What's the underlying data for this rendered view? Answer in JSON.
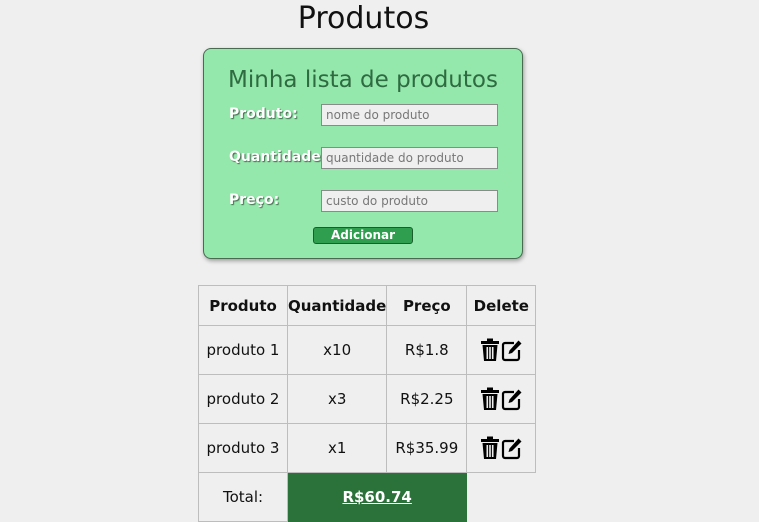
{
  "page": {
    "title": "Produtos"
  },
  "form": {
    "title": "Minha lista de produtos",
    "fields": [
      {
        "label": "Produto:",
        "placeholder": "nome do produto",
        "value": ""
      },
      {
        "label": "Quantidade:",
        "placeholder": "quantidade do produto",
        "value": ""
      },
      {
        "label": "Preço:",
        "placeholder": "custo do produto",
        "value": ""
      }
    ],
    "submit_label": "Adicionar"
  },
  "table": {
    "headers": [
      "Produto",
      "Quantidade",
      "Preço",
      "Delete"
    ],
    "rows": [
      {
        "name": "produto 1",
        "qty": "x10",
        "price": "R$1.8"
      },
      {
        "name": "produto 2",
        "qty": "x3",
        "price": "R$2.25"
      },
      {
        "name": "produto 3",
        "qty": "x1",
        "price": "R$35.99"
      }
    ],
    "total_label": "Total:",
    "total_value": "R$60.74"
  },
  "icons": {
    "delete": "trash-icon",
    "edit": "edit-icon"
  },
  "colors": {
    "background": "#efefef",
    "card": "#94e8ab",
    "card_title": "#2f6a41",
    "button": "#2f9e4e",
    "total": "#2b713a"
  }
}
